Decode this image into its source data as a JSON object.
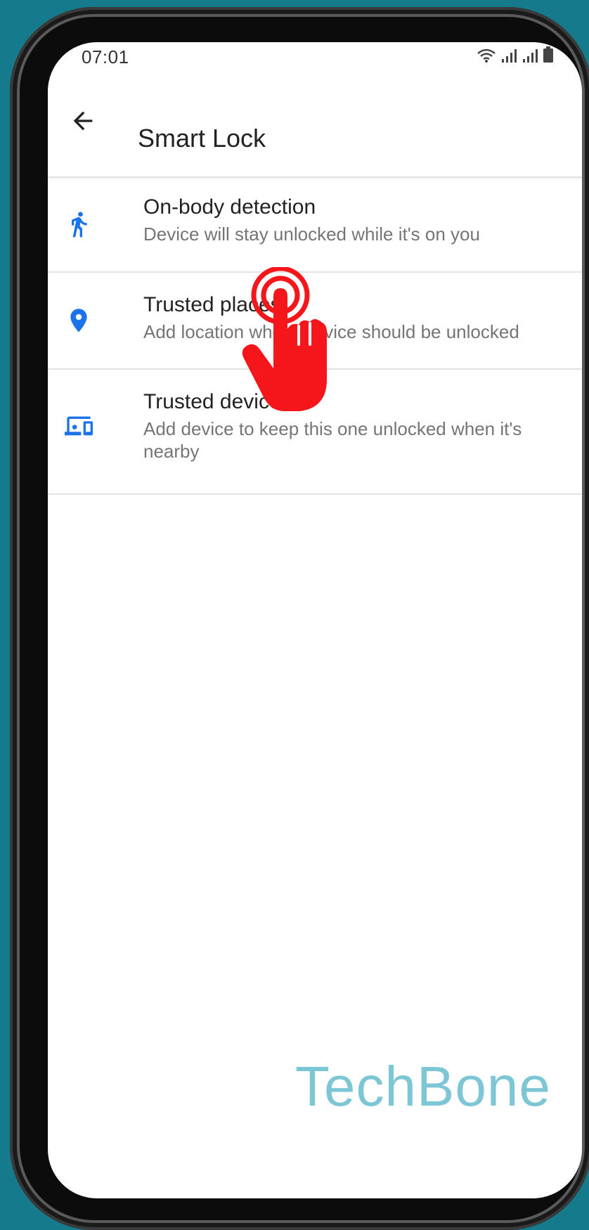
{
  "status_bar": {
    "time": "07:01"
  },
  "app_bar": {
    "title": "Smart Lock",
    "back_icon": "arrow-back-icon"
  },
  "items": [
    {
      "icon": "walking-person-icon",
      "title": "On-body detection",
      "subtitle": "Device will stay unlocked while it's on you"
    },
    {
      "icon": "location-pin-icon",
      "title": "Trusted places",
      "subtitle": "Add location where device should be unlocked"
    },
    {
      "icon": "devices-icon",
      "title": "Trusted devices",
      "subtitle": "Add device to keep this one unlocked when it's nearby"
    }
  ],
  "colors": {
    "accent": "#1a73e8",
    "tap_indicator": "#f4161a",
    "background": "#147a8c",
    "watermark": "#7cc6d6"
  },
  "watermark": "TechBone"
}
